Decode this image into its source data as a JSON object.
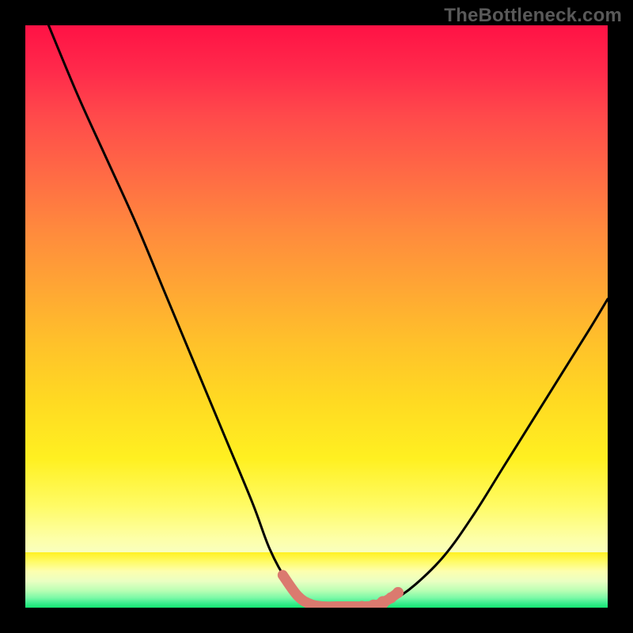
{
  "watermark": "TheBottleneck.com",
  "chart_data": {
    "type": "line",
    "title": "",
    "xlabel": "",
    "ylabel": "",
    "xlim": [
      0,
      100
    ],
    "ylim": [
      0,
      100
    ],
    "series": [
      {
        "name": "left-curve",
        "x": [
          4,
          9,
          14,
          19,
          24,
          29,
          34,
          39,
          42,
          45,
          48,
          50
        ],
        "values": [
          100,
          88,
          77,
          66,
          54,
          42,
          30,
          18,
          10,
          4.5,
          1.2,
          0.2
        ]
      },
      {
        "name": "right-curve",
        "x": [
          60,
          63,
          67,
          72,
          77,
          82,
          87,
          92,
          97,
          100
        ],
        "values": [
          0.2,
          1.2,
          4,
          9,
          16,
          24,
          32,
          40,
          48,
          53
        ]
      },
      {
        "name": "flat-min",
        "x": [
          50,
          51,
          53,
          55,
          57,
          59,
          60
        ],
        "values": [
          0.2,
          0.0,
          0.0,
          0.0,
          0.0,
          0.0,
          0.2
        ]
      }
    ],
    "markers": {
      "name": "salmon-dots",
      "color": "#db7a6f",
      "points": [
        {
          "x": 44.2,
          "y": 5.6,
          "r": 6
        },
        {
          "x": 46.8,
          "y": 2.0,
          "r": 5
        },
        {
          "x": 49.0,
          "y": 0.6,
          "r": 6
        },
        {
          "x": 51.2,
          "y": 0.2,
          "r": 6
        },
        {
          "x": 53.4,
          "y": 0.2,
          "r": 6
        },
        {
          "x": 55.6,
          "y": 0.2,
          "r": 6
        },
        {
          "x": 57.8,
          "y": 0.2,
          "r": 7
        },
        {
          "x": 59.8,
          "y": 0.3,
          "r": 8
        },
        {
          "x": 61.4,
          "y": 0.9,
          "r": 8
        },
        {
          "x": 62.8,
          "y": 1.7,
          "r": 7
        },
        {
          "x": 64.0,
          "y": 2.6,
          "r": 7
        }
      ]
    },
    "gradient_stops": [
      {
        "pos": 0,
        "color": "#ff1245"
      },
      {
        "pos": 50,
        "color": "#ffb82f"
      },
      {
        "pos": 78,
        "color": "#fff021"
      },
      {
        "pos": 100,
        "color": "#13e671"
      }
    ]
  }
}
